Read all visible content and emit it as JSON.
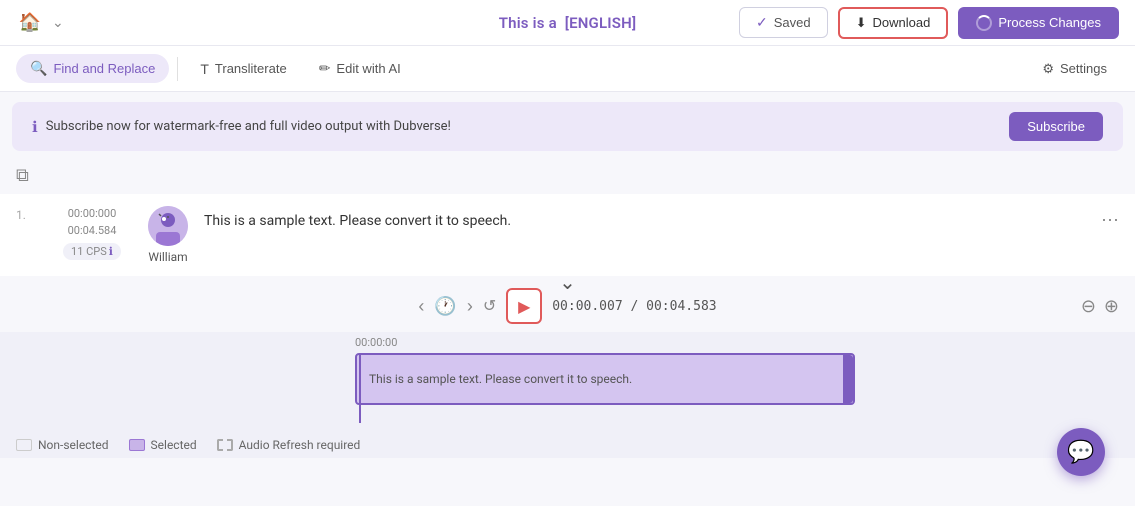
{
  "header": {
    "home_icon": "🏠",
    "chevron_icon": "⌄",
    "title": "This is a",
    "title_lang": "[ENGLISH]",
    "saved_label": "Saved",
    "download_label": "Download",
    "process_label": "Process Changes"
  },
  "toolbar": {
    "find_replace_label": "Find and Replace",
    "transliterate_label": "Transliterate",
    "edit_with_label": "Edit with AI",
    "settings_label": "Settings"
  },
  "banner": {
    "info_text": "Subscribe now for watermark-free and full video output with Dubverse!",
    "subscribe_label": "Subscribe"
  },
  "transcript": {
    "line_number": "1.",
    "time_start": "00:00:000",
    "time_end": "00:04.584",
    "cps_label": "11 CPS",
    "speaker_name": "William",
    "text": "This is a sample text. Please convert it to speech."
  },
  "player": {
    "current_time": "00:00.007",
    "total_time": "00:04.583",
    "time_separator": "/"
  },
  "timeline": {
    "ruler_label": "00:00:00",
    "segment_text": "This is a sample text. Please convert it to speech."
  },
  "legend": {
    "items": [
      {
        "label": "Non-selected",
        "type": "nonselected"
      },
      {
        "label": "Selected",
        "type": "selected"
      },
      {
        "label": "Audio Refresh required",
        "type": "audio"
      }
    ]
  }
}
